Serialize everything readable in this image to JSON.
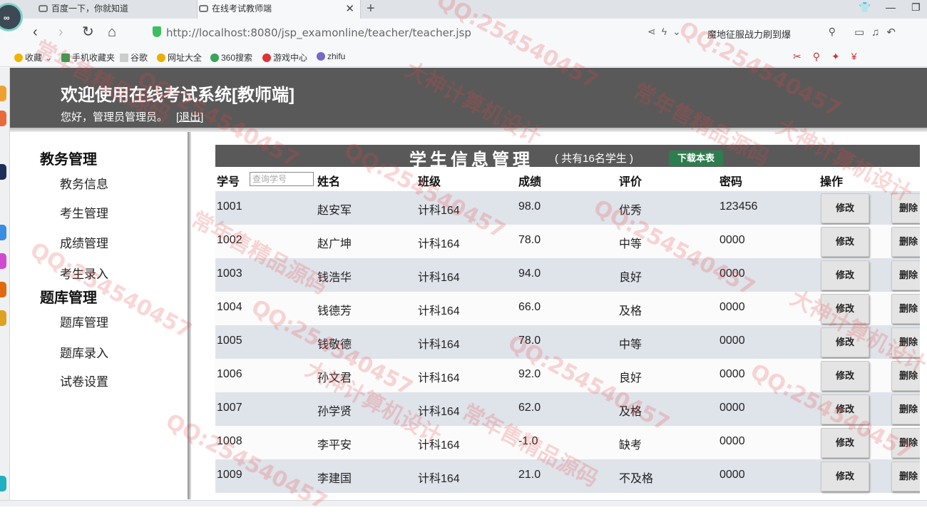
{
  "browser": {
    "tabs": [
      {
        "label": "百度一下，你就知道",
        "active": false
      },
      {
        "label": "在线考试教师端",
        "active": true
      }
    ],
    "url": "http://localhost:8080/jsp_examonline/teacher/teacher.jsp",
    "search_text": "魔地征服战力刷到爆",
    "bookmarks": [
      "收藏",
      "手机收藏夹",
      "谷歌",
      "网址大全",
      "360搜索",
      "游戏中心",
      "zhifu"
    ]
  },
  "header": {
    "title": "欢迎使用在线考试系统[教师端]",
    "welcome": "您好，管理员管理员。",
    "logout": "[退出]"
  },
  "menu": {
    "group1": "教务管理",
    "group1_items": [
      "教务信息",
      "考生管理",
      "成绩管理",
      "考生录入"
    ],
    "group2": "题库管理",
    "group2_items": [
      "题库管理",
      "题库录入",
      "试卷设置"
    ]
  },
  "content": {
    "title": "学生信息管理",
    "count": "( 共有16名学生 )",
    "download": "下载本表",
    "search_placeholder": "查询学号",
    "columns": [
      "学号",
      "姓名",
      "班级",
      "成绩",
      "评价",
      "密码",
      "操作"
    ],
    "edit_label": "修改",
    "delete_label": "删除",
    "rows": [
      {
        "id": "1001",
        "name": "赵安军",
        "class": "计科164",
        "score": "98.0",
        "grade": "优秀",
        "pwd": "123456"
      },
      {
        "id": "1002",
        "name": "赵广坤",
        "class": "计科164",
        "score": "78.0",
        "grade": "中等",
        "pwd": "0000"
      },
      {
        "id": "1003",
        "name": "钱浩华",
        "class": "计科164",
        "score": "94.0",
        "grade": "良好",
        "pwd": "0000"
      },
      {
        "id": "1004",
        "name": "钱德芳",
        "class": "计科164",
        "score": "66.0",
        "grade": "及格",
        "pwd": "0000"
      },
      {
        "id": "1005",
        "name": "钱敬德",
        "class": "计科164",
        "score": "78.0",
        "grade": "中等",
        "pwd": "0000"
      },
      {
        "id": "1006",
        "name": "孙文君",
        "class": "计科164",
        "score": "92.0",
        "grade": "良好",
        "pwd": "0000"
      },
      {
        "id": "1007",
        "name": "孙学贤",
        "class": "计科164",
        "score": "62.0",
        "grade": "及格",
        "pwd": "0000"
      },
      {
        "id": "1008",
        "name": "李平安",
        "class": "计科164",
        "score": "-1.0",
        "grade": "缺考",
        "pwd": "0000"
      },
      {
        "id": "1009",
        "name": "李建国",
        "class": "计科164",
        "score": "21.0",
        "grade": "不及格",
        "pwd": "0000"
      }
    ]
  },
  "watermark": [
    "QQ:254540457",
    "大神计算机设计",
    "常年售精品源码"
  ]
}
